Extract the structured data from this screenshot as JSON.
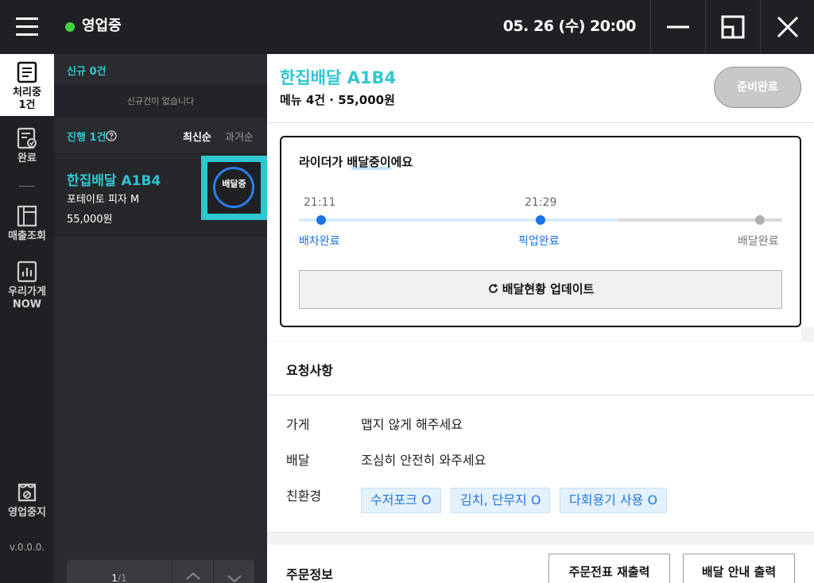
{
  "topbar": {
    "status_text": "영업중",
    "status_color": "#3fd53f",
    "datetime": "05. 26 (수) 20:00",
    "icons": [
      "hamburger-icon",
      "minimize-icon",
      "restore-icon",
      "close-icon"
    ]
  },
  "nav": {
    "items": [
      {
        "label_line1": "처리중",
        "label_line2": "1건",
        "icon": "document-list-icon",
        "active": true
      },
      {
        "label": "완료",
        "icon": "document-check-icon"
      },
      {
        "label": "매출조회",
        "icon": "ledger-icon"
      },
      {
        "label_line1": "우리가게",
        "label_line2": "NOW",
        "icon": "bar-chart-icon"
      },
      {
        "label": "영업중지",
        "icon": "store-closed-icon"
      }
    ],
    "version": "v.0.0.0."
  },
  "orders": {
    "new_title": "신규 0건",
    "new_empty": "신규건이 없습니다",
    "progress_title": "진행 1건",
    "sort_newest": "최신순",
    "sort_oldest": "과거순",
    "list": [
      {
        "name": "한집배달 A1B4",
        "menu": "포테이토 피자 M",
        "price": "55,000원",
        "badge": "배달중"
      }
    ],
    "pager": {
      "current": "1",
      "total": "/1"
    }
  },
  "detail": {
    "title": "한집배달 A1B4",
    "subtitle": "메뉴 4건 · 55,000원",
    "ready_button": "준비완료",
    "tracking": {
      "title": "라이더가 배달중이에요",
      "steps": [
        {
          "time": "21:11",
          "label": "배차완료",
          "done": true
        },
        {
          "time": "21:29",
          "label": "픽업완료",
          "done": true
        },
        {
          "time": "",
          "label": "배달완료",
          "done": false
        }
      ],
      "update_button": "배달현황 업데이트"
    },
    "requests": {
      "title": "요청사항",
      "rows": [
        {
          "label": "가게",
          "value": "맵지 않게 해주세요"
        },
        {
          "label": "배달",
          "value": "조심히 안전히 와주세요"
        },
        {
          "label": "친환경",
          "value": ""
        }
      ],
      "eco_tags": [
        "수저포크 O",
        "김치, 단무지 O",
        "다회용기 사용 O"
      ]
    },
    "order_info": {
      "title": "주문정보",
      "reprint_button": "주문전표 재출력",
      "delivery_guide_button": "배달 안내 출력"
    }
  },
  "colors": {
    "accent": "#2fc6d0",
    "blue": "#1a73e8",
    "dark": "#1f2024"
  }
}
